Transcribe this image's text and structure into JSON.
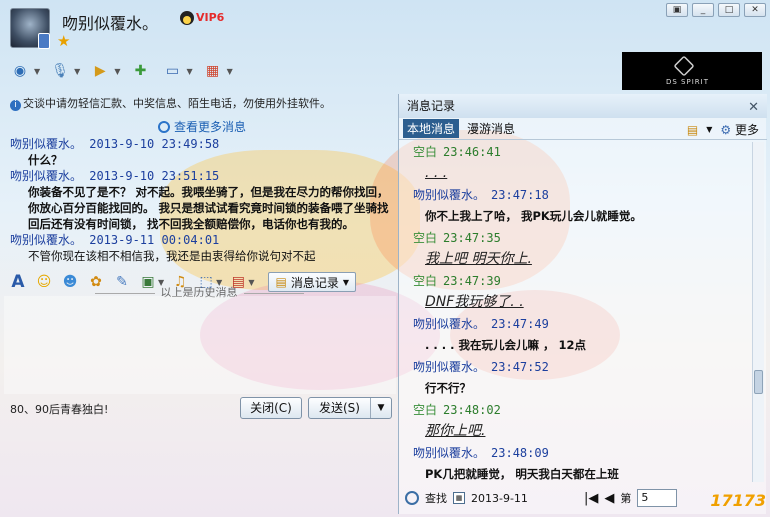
{
  "header": {
    "nickname": "吻别似覆水。",
    "vip_label": "VIP6",
    "ad_text": "DS SPIRIT"
  },
  "notice": "交谈中请勿轻信汇款、中奖信息、陌生电话，勿使用外挂软件。",
  "more_messages": "查看更多消息",
  "history": [
    {
      "head": "吻别似覆水。  2013-9-10 23:49:58",
      "body": "什么？",
      "bold": true
    },
    {
      "head": "吻别似覆水。  2013-9-10 23:51:15",
      "body": "你装备不见了是不？      对不起。我喂坐骑了，但是我在尽力的帮你找回， 你放心百分百能找回的。 我只是想试试看究竟时间锁的装备喂了坐骑找回后还有没有时间锁，        找不回我全额赔偿你，电话你也有我的。",
      "bold": true
    },
    {
      "head": "吻别似覆水。  2013-9-11 00:04:01",
      "body": "不管你现在该相不相信我，我还是由衷得给你说句对不起",
      "bold": false
    }
  ],
  "history_separator": "以上是历史消息",
  "input_toolbar": {
    "msg_record_label": "消息记录"
  },
  "footer": {
    "signature": "80、90后青春独白!",
    "close_label": "关闭(C)",
    "send_label": "发送(S)"
  },
  "record_panel": {
    "title": "消息记录",
    "tabs": [
      "本地消息",
      "漫游消息"
    ],
    "more_label": "更多",
    "items": [
      {
        "name": "空白",
        "time": "23:46:41",
        "body": ". . .",
        "self": true,
        "style": "ul"
      },
      {
        "name": "吻别似覆水。",
        "time": "23:47:18",
        "body": "你不上我上了哈， 我PK玩儿会儿就睡觉。",
        "self": false,
        "style": "bold"
      },
      {
        "name": "空白",
        "time": "23:47:35",
        "body": "我上吧  明天你上.",
        "self": true,
        "style": "ul"
      },
      {
        "name": "空白",
        "time": "23:47:39",
        "body": "DNF我玩够了. .",
        "self": true,
        "style": "ul"
      },
      {
        "name": "吻别似覆水。",
        "time": "23:47:49",
        "body": ". . . . 我在玩儿会儿嘛 ， 12点",
        "self": false,
        "style": "bold"
      },
      {
        "name": "吻别似覆水。",
        "time": "23:47:52",
        "body": "行不行？",
        "self": false,
        "style": "bold"
      },
      {
        "name": "空白",
        "time": "23:48:02",
        "body": "那你上吧.",
        "self": true,
        "style": "ul"
      },
      {
        "name": "吻别似覆水。",
        "time": "23:48:09",
        "body": "PK几把就睡觉， 明天我白天都在上班",
        "self": false,
        "style": "bold"
      }
    ],
    "footer": {
      "search_label": "查找",
      "date": "2013-9-11",
      "page_label": "第",
      "page_value": "5"
    },
    "logo_text": "17173"
  }
}
